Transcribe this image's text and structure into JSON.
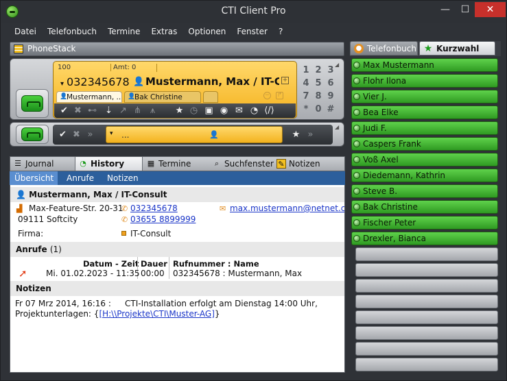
{
  "window": {
    "title": "CTI Client Pro",
    "controls": {
      "minimize": "—",
      "maximize": "☐",
      "close": "✕"
    }
  },
  "menu": [
    "Datei",
    "Telefonbuch",
    "Termine",
    "Extras",
    "Optionen",
    "Fenster",
    "?"
  ],
  "phonestack": {
    "label": "PhoneStack",
    "line1": {
      "extension": "100",
      "amt": "Amt: 0",
      "number": "032345678",
      "caller": "Mustermann, Max  /  IT-C...",
      "expand": "+",
      "tabs": [
        "Mustermann, ...",
        "Bak Christine"
      ],
      "keypad": [
        "1",
        "2",
        "3",
        "4",
        "5",
        "6",
        "7",
        "8",
        "9",
        "*",
        "0",
        "#"
      ]
    },
    "line2": {
      "input_value": "...",
      "more": "»"
    }
  },
  "tabs": [
    {
      "label": "Journal",
      "icon": "journal-icon"
    },
    {
      "label": "History",
      "icon": "history-icon"
    },
    {
      "label": "Termine",
      "icon": "calendar-icon"
    },
    {
      "label": "Suchfenster",
      "icon": "search-icon"
    },
    {
      "label": "Notizen",
      "icon": "notes-icon"
    }
  ],
  "subtabs": [
    "Übersicht",
    "Anrufe",
    "Notizen"
  ],
  "contact": {
    "name": "Mustermann, Max / IT-Consult",
    "street": "Max-Feature-Str. 20-31",
    "city": "09111 Softcity",
    "phone1": "032345678",
    "phone2": "03655 8899999",
    "email": "max.mustermann@netnet.com",
    "firma_label": "Firma:",
    "firma_value": "IT-Consult"
  },
  "calls": {
    "heading": "Anrufe",
    "count": "(1)",
    "columns": [
      "Datum - Zeit",
      "Dauer",
      "Rufnummer : Name"
    ],
    "rows": [
      {
        "datetime": "Mi. 01.02.2023 - 11:35",
        "duration": "00:00",
        "number_name": "032345678 : Mustermann, Max"
      }
    ]
  },
  "notes": {
    "heading": "Notizen",
    "date": "Fr 07 Mrz 2014, 16:16 :",
    "text": "CTI-Installation erfolgt am Dienstag 14:00 Uhr,",
    "line2_prefix": "Projektunterlagen: {",
    "link": "[H:\\\\Projekte\\CTI\\Muster-AG]",
    "line2_suffix": "}"
  },
  "right_panel": {
    "tabs": [
      "Telefonbuch",
      "Kurzwahl"
    ],
    "speed_dial": [
      "Max Mustermann",
      "Flohr Ilona",
      "Vier J.",
      "Bea Elke",
      "Judi F.",
      "Caspers Frank",
      "Voß Axel",
      "Diedemann, Kathrin",
      "Steve B.",
      "Bak Christine",
      "Fischer Peter",
      "Drexler, Bianca"
    ],
    "empty_slots": 8
  },
  "colors": {
    "accent_orange": "#f5b21e",
    "speed_green": "#2f9a22",
    "subtab_blue": "#2c5f9c",
    "close_red": "#c7302b"
  }
}
